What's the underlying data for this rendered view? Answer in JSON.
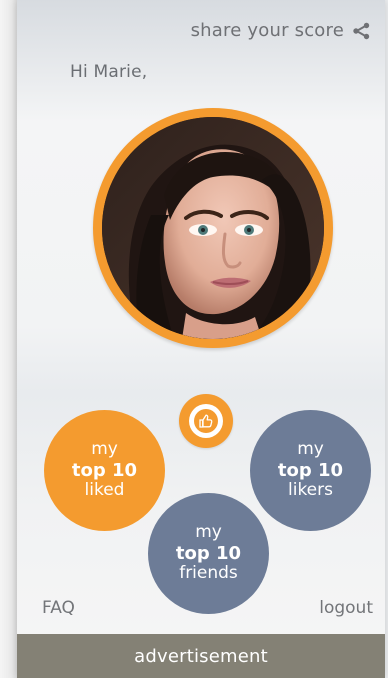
{
  "header": {
    "share_label": "share your score",
    "greeting": "Hi Marie,"
  },
  "profile": {
    "icon": "profile-photo"
  },
  "actions": {
    "liked": {
      "line1": "my",
      "line2": "top 10",
      "line3": "liked"
    },
    "likers": {
      "line1": "my",
      "line2": "top 10",
      "line3": "likers"
    },
    "friends": {
      "line1": "my",
      "line2": "top 10",
      "line3": "friends"
    }
  },
  "footer": {
    "faq": "FAQ",
    "logout": "logout",
    "advertisement": "advertisement"
  },
  "colors": {
    "accent": "#f49b2f",
    "secondary": "#6d7c97",
    "ad_bar": "#848175"
  }
}
